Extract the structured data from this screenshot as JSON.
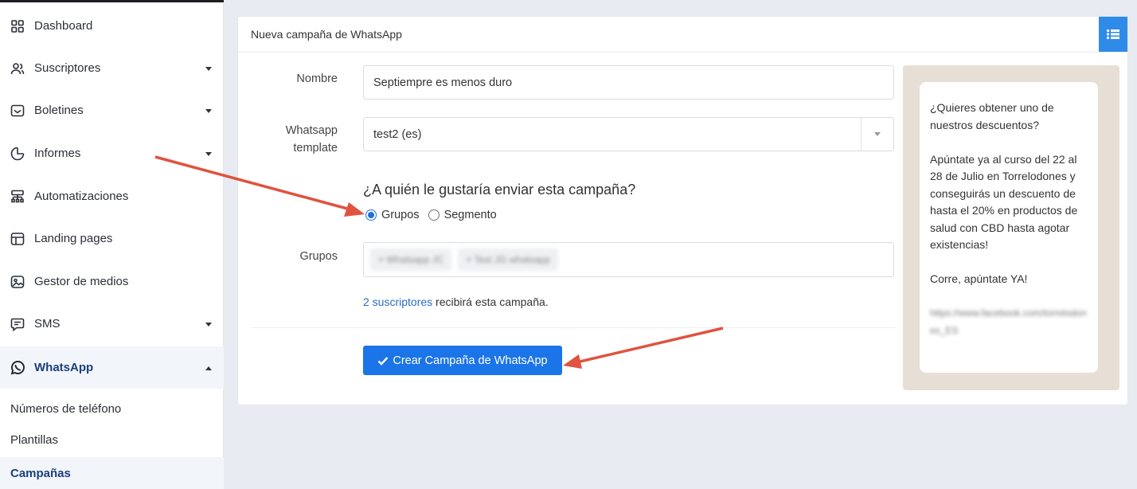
{
  "sidebar": {
    "items": [
      {
        "label": "Dashboard",
        "icon": "grid-icon",
        "caret": false
      },
      {
        "label": "Suscriptores",
        "icon": "users-icon",
        "caret": true
      },
      {
        "label": "Boletines",
        "icon": "inbox-icon",
        "caret": true
      },
      {
        "label": "Informes",
        "icon": "pie-chart-icon",
        "caret": true
      },
      {
        "label": "Automatizaciones",
        "icon": "hierarchy-icon",
        "caret": false
      },
      {
        "label": "Landing pages",
        "icon": "layout-icon",
        "caret": false
      },
      {
        "label": "Gestor de medios",
        "icon": "image-icon",
        "caret": false
      },
      {
        "label": "SMS",
        "icon": "message-icon",
        "caret": true
      },
      {
        "label": "WhatsApp",
        "icon": "whatsapp-icon",
        "caret": true
      }
    ],
    "subitems": [
      {
        "label": "Números de teléfono"
      },
      {
        "label": "Plantillas"
      },
      {
        "label": "Campañas"
      }
    ]
  },
  "card": {
    "title": "Nueva campaña de WhatsApp"
  },
  "form": {
    "name_label": "Nombre",
    "name_value": "Septiempre es menos duro",
    "template_label_1": "Whatsapp",
    "template_label_2": "template",
    "template_value": "test2 (es)",
    "question": "¿A quién le gustaría enviar esta campaña?",
    "radio_groups": "Grupos",
    "radio_segment": "Segmento",
    "groups_label": "Grupos",
    "group_chips": [
      "× Whatsapp JC",
      "× Test JG whatsapp"
    ],
    "subscribers_link": "2 suscriptores",
    "subscribers_text": " recibirá esta campaña.",
    "submit_label": "Crear Campaña de WhatsApp"
  },
  "promo": {
    "paragraph_1": "¿Quieres obtener uno de nuestros descuentos?",
    "paragraph_2": "Apúntate ya al curso del 22 al 28 de Julio en Torrelodones y conseguirás un descuento de hasta el 20% en productos de salud con CBD hasta agotar existencias!",
    "paragraph_3": "Corre, apúntate YA!",
    "link": "https://www.facebook.com/torrelodones_ES"
  },
  "colors": {
    "primary": "#1b74e8",
    "header_button": "#2f8be8",
    "annotation_arrow": "#e0533f",
    "promo_bg": "#e7ded6"
  }
}
